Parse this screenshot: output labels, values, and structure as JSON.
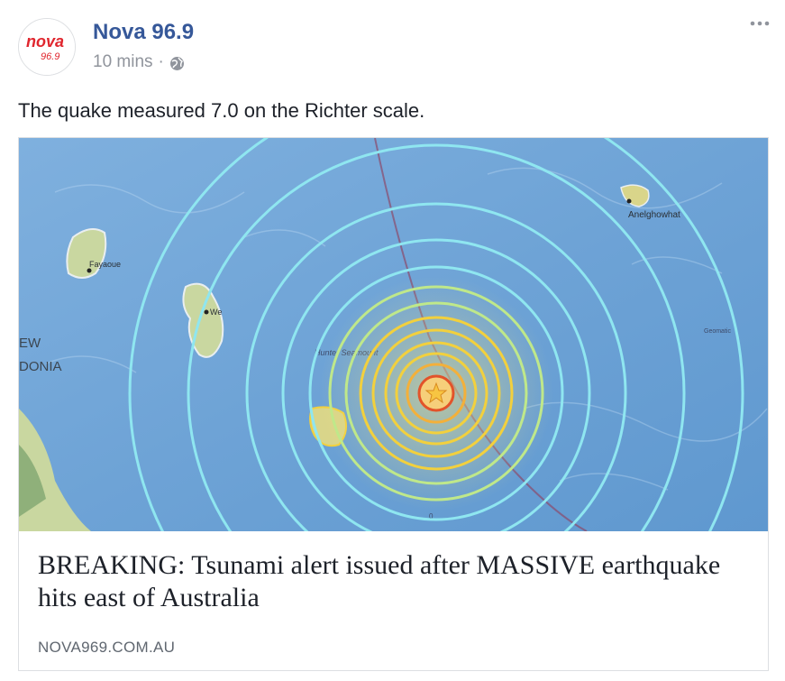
{
  "post": {
    "page_name": "Nova 96.9",
    "timestamp": "10 mins",
    "meta_separator": "·",
    "privacy_icon": "globe-icon",
    "more_icon": "ellipsis-icon",
    "text": "The quake measured 7.0 on the Richter scale.",
    "avatar": {
      "logo_word": "nova",
      "logo_number": "96.9",
      "logo_color": "#e0262e"
    }
  },
  "link_card": {
    "title": "BREAKING: Tsunami alert issued after MASSIVE earthquake hits east of Australia",
    "domain": "NOVA969.COM.AU",
    "image": {
      "labels": {
        "anelghowhat": "Anelghowhat",
        "fayaoue": "Fayaoue",
        "we": "We",
        "hunter_seamount": "Hunter Seamount",
        "new": "EW",
        "caledonia": "DONIA",
        "geomatic": "Geomatic",
        "zero": "0"
      },
      "epicenter_icon": "star-icon",
      "colors": {
        "sea": "#6ea3d6",
        "land": "#c9d7a0",
        "outer_rings": "#8fe6f0",
        "inner_rings": "#f2d03d",
        "epicenter": "#e2532a"
      }
    }
  },
  "colors": {
    "link_blue": "#365899",
    "text": "#1d2129",
    "meta_gray": "#90949c",
    "border": "#dddfe2"
  }
}
